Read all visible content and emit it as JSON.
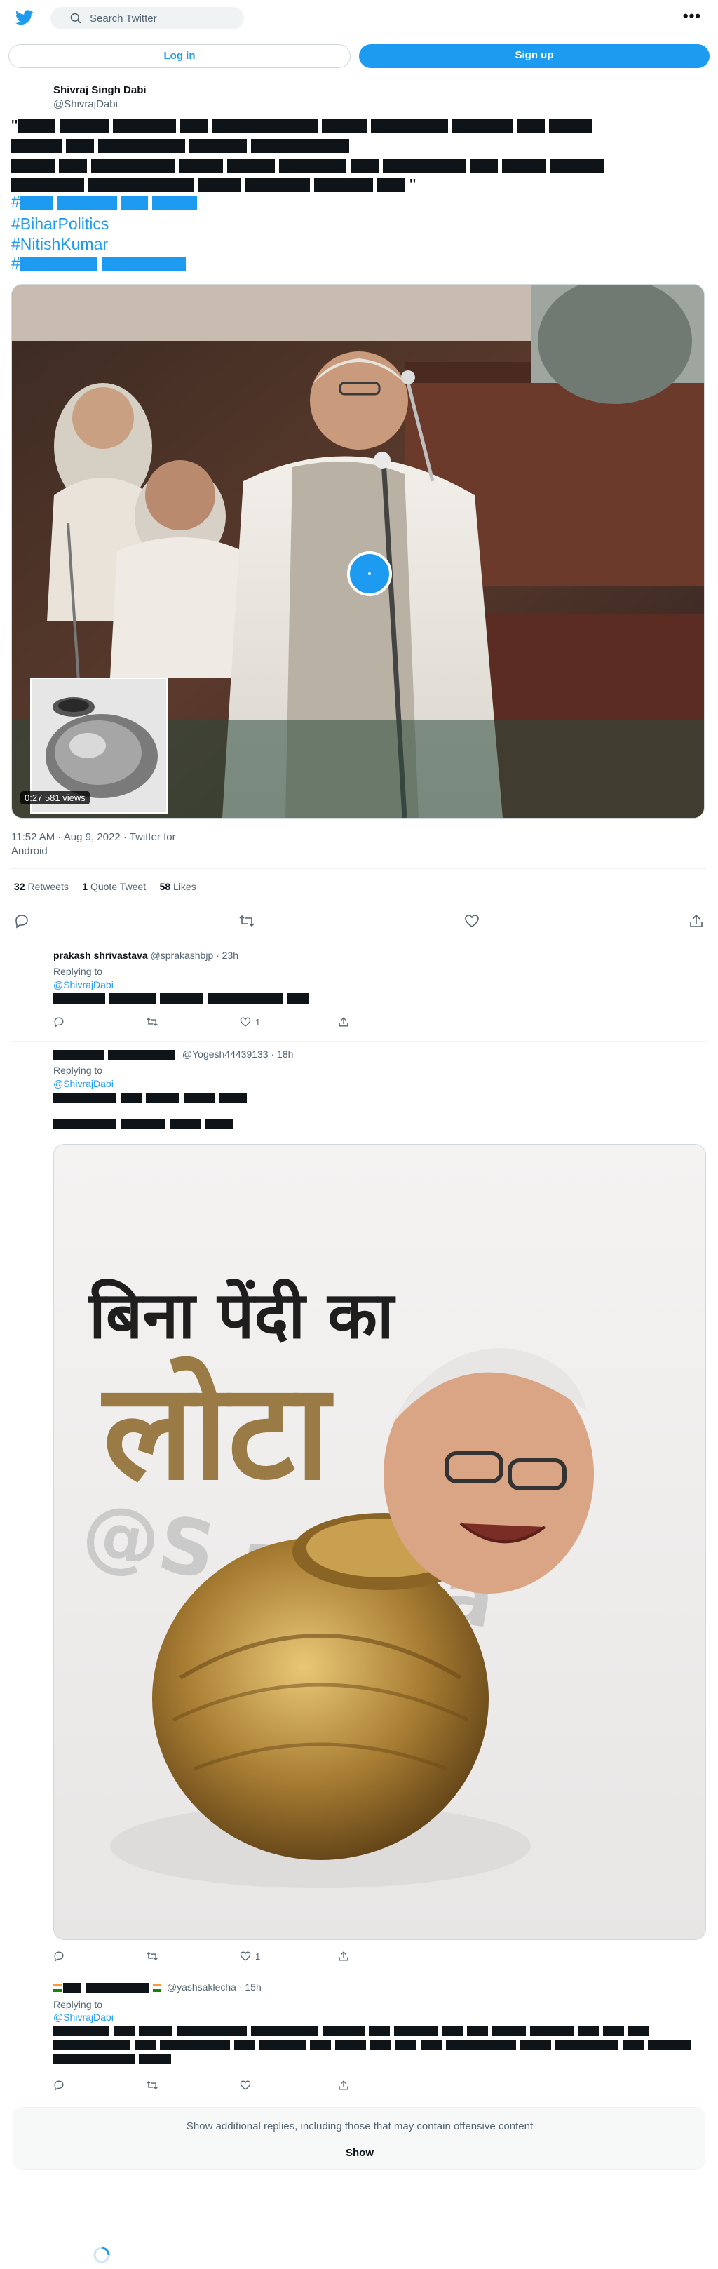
{
  "header": {
    "search_placeholder": "Search Twitter",
    "more_label": "•••"
  },
  "auth": {
    "login_label": "Log in",
    "signup_label": "Sign up"
  },
  "tweet": {
    "author_name": "Shivraj Singh Dabi",
    "author_handle": "@ShivrajDabi",
    "hashtags": [
      "#BiharPolitics",
      "#NitishKumar"
    ],
    "video_duration": "0:27",
    "video_views": "581 views",
    "timestamp": "11:52 AM · Aug 9, 2022 · Twitter for Android",
    "retweets_count": "32",
    "retweets_label": "Retweets",
    "quotes_count": "1",
    "quotes_label": "Quote Tweet",
    "likes_count": "58",
    "likes_label": "Likes"
  },
  "replies": [
    {
      "name": "prakash shrivastava",
      "handle": "@sprakashbjp",
      "time": "· 23h",
      "replying_to_label": "Replying to",
      "replying_to": "@ShivrajDabi",
      "like_count": "1"
    },
    {
      "handle": "@Yogesh44439133",
      "time": "· 18h",
      "replying_to_label": "Replying to",
      "replying_to": "@ShivrajDabi",
      "image_heading": "बिना पेंदी का",
      "image_word": "लोटा",
      "image_watermark": "@S          ashaa",
      "like_count": "1"
    },
    {
      "handle": "@yashsaklecha",
      "time": "· 15h",
      "replying_to_label": "Replying to",
      "replying_to": "@ShivrajDabi"
    }
  ],
  "additional": {
    "text": "Show additional replies, including those that may contain offensive content",
    "button": "Show"
  },
  "colors": {
    "accent": "#1d9bf0",
    "text": "#0f1419",
    "muted": "#536471"
  }
}
